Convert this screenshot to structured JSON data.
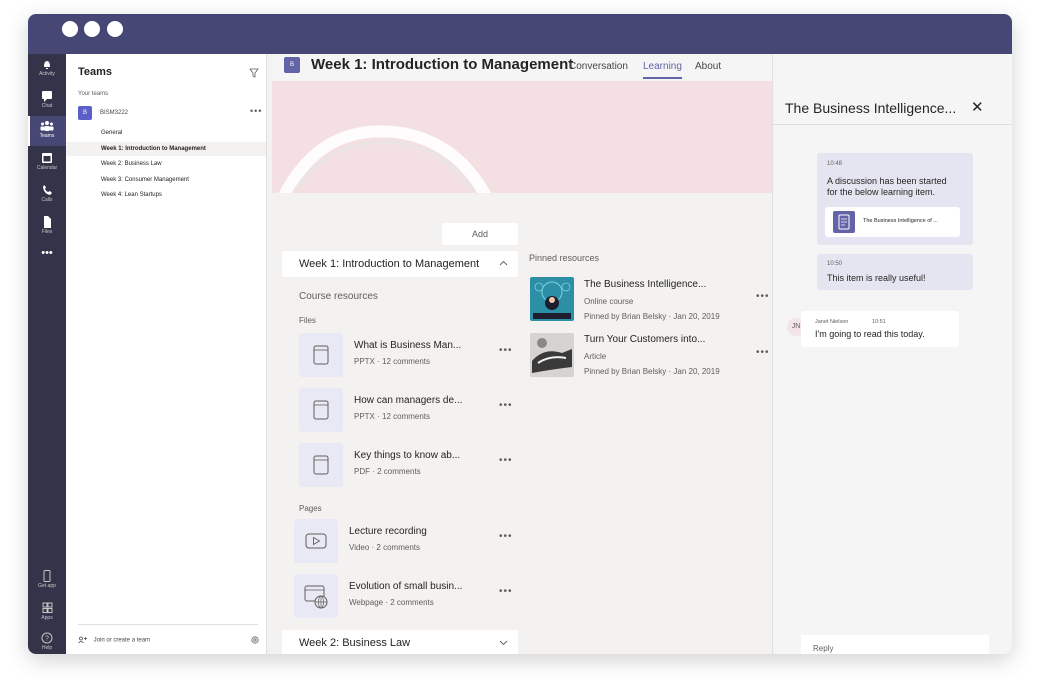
{
  "rail": {
    "items": [
      {
        "label": "Activity",
        "icon": "bell-icon"
      },
      {
        "label": "Chat",
        "icon": "chat-icon"
      },
      {
        "label": "Teams",
        "icon": "teams-icon",
        "active": true
      },
      {
        "label": "Calendar",
        "icon": "calendar-icon"
      },
      {
        "label": "Calls",
        "icon": "phone-icon"
      },
      {
        "label": "Files",
        "icon": "file-icon"
      }
    ],
    "more": "•••",
    "bottom": [
      {
        "label": "Get app",
        "icon": "device-icon"
      },
      {
        "label": "Apps",
        "icon": "apps-icon"
      },
      {
        "label": "Help",
        "icon": "help-icon"
      }
    ]
  },
  "teams": {
    "title": "Teams",
    "section_label": "Your teams",
    "team": {
      "avatar": "B",
      "name": "BISM3222",
      "more": "•••"
    },
    "channels": [
      {
        "label": "General"
      },
      {
        "label": "Week 1: Introduction to Management",
        "active": true
      },
      {
        "label": "Week 2: Business Law"
      },
      {
        "label": "Week 3: Consumer Management"
      },
      {
        "label": "Week 4: Lean Startups"
      }
    ],
    "join_label": "Join or create a team"
  },
  "channel": {
    "avatar": "B",
    "title": "Week 1: Introduction to Management",
    "tabs": [
      {
        "label": "Conversation"
      },
      {
        "label": "Learning",
        "active": true
      },
      {
        "label": "About"
      }
    ]
  },
  "learning": {
    "add_label": "Add",
    "section1_title": "Week 1: Introduction to Management",
    "course_resources_label": "Course resources",
    "files_label": "Files",
    "files": [
      {
        "title": "What is Business Man...",
        "meta": "PPTX · 12 comments"
      },
      {
        "title": "How can managers de...",
        "meta": "PPTX · 12 comments"
      },
      {
        "title": "Key things to know ab...",
        "meta": "PDF · 2 comments"
      }
    ],
    "pages_label": "Pages",
    "pages": [
      {
        "title": "Lecture recording",
        "meta": "Video · 2 comments",
        "icon": "video-icon"
      },
      {
        "title": "Evolution of small busin...",
        "meta": "Webpage · 2 comments",
        "icon": "webpage-icon"
      }
    ],
    "section2_title": "Week 2: Business Law",
    "more": "•••"
  },
  "pinned": {
    "label": "Pinned resources",
    "items": [
      {
        "title": "The Business Intelligence...",
        "type": "Online course",
        "meta": "Pinned by Brian Belsky · Jan 20, 2019"
      },
      {
        "title": "Turn Your Customers into...",
        "type": "Article",
        "meta": "Pinned by Brian Belsky · Jan 20, 2019"
      }
    ]
  },
  "discussion": {
    "title": "The Business Intelligence...",
    "close": "✕",
    "messages": [
      {
        "time": "10:48",
        "text_line1": "A discussion has been started",
        "text_line2": "for the below learning item.",
        "card_text": "The Business Intelligence of ..."
      },
      {
        "time": "10:50",
        "text": "This item is really useful!"
      }
    ],
    "author_message": {
      "initials": "JN",
      "name": "Janet Nielsen",
      "time": "10:51",
      "text": "I'm going to read this today."
    },
    "reply_placeholder": "Reply"
  }
}
